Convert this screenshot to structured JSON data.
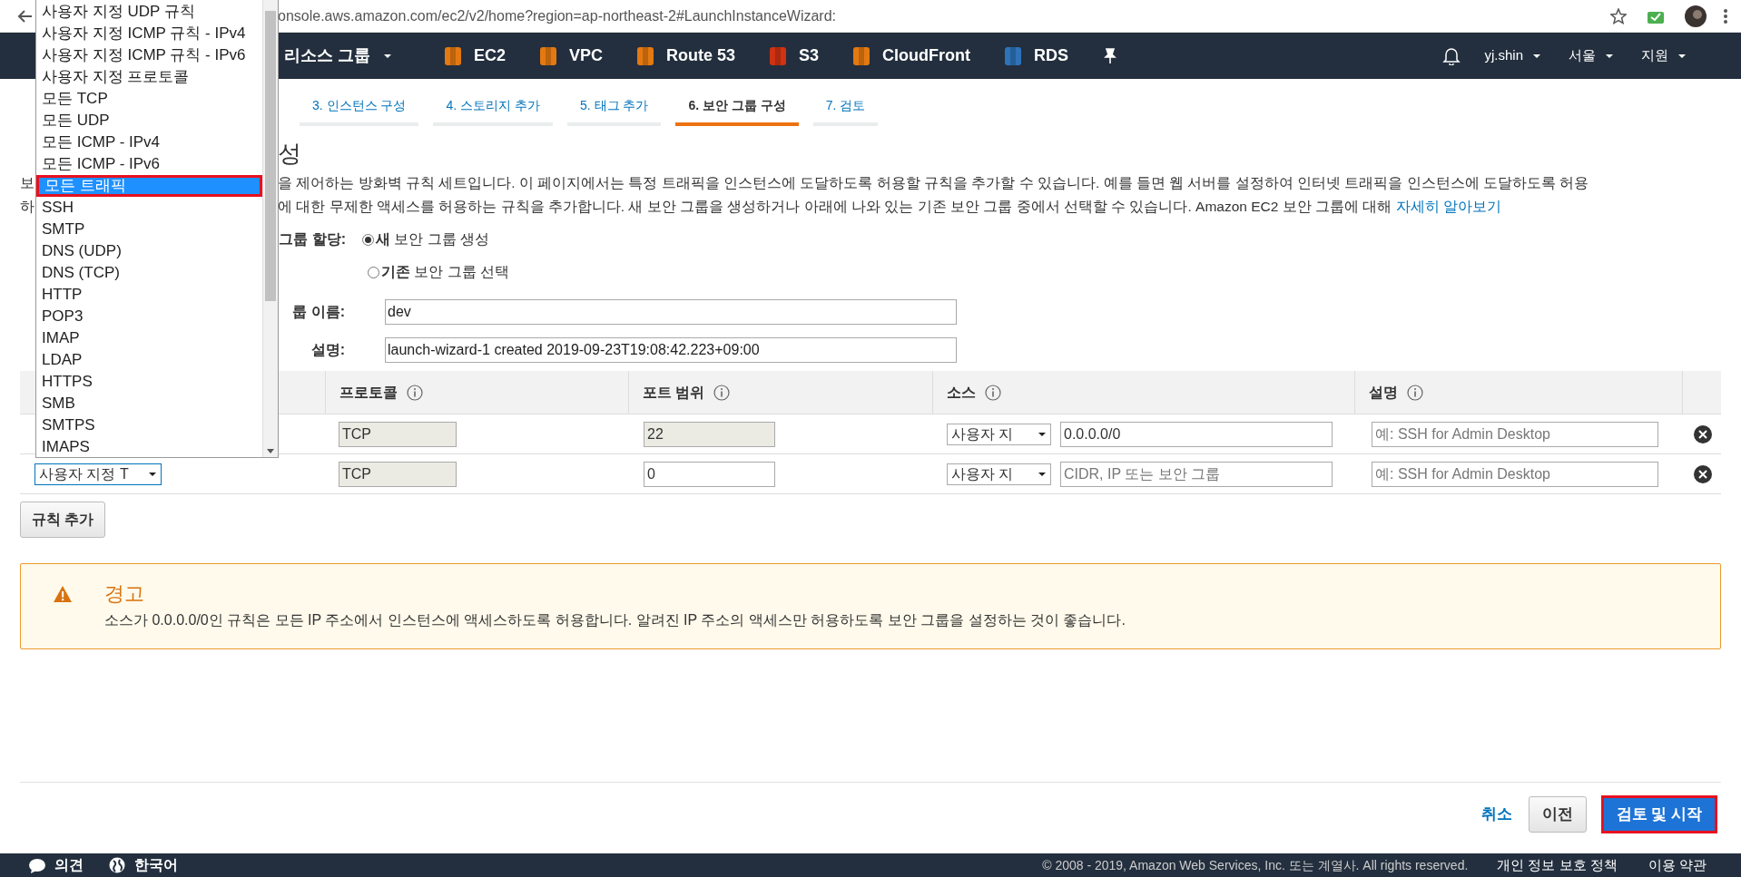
{
  "browser": {
    "url": "onsole.aws.amazon.com/ec2/v2/home?region=ap-northeast-2#LaunchInstanceWizard:"
  },
  "nav": {
    "menu": "리소스 그룹",
    "services": [
      {
        "label": "EC2",
        "color": "#e47911"
      },
      {
        "label": "VPC",
        "color": "#e47911"
      },
      {
        "label": "Route 53",
        "color": "#e47911"
      },
      {
        "label": "S3",
        "color": "#d13212"
      },
      {
        "label": "CloudFront",
        "color": "#e47911"
      },
      {
        "label": "RDS",
        "color": "#2e73b8"
      }
    ],
    "right": [
      "yj.shin",
      "서울",
      "지원"
    ]
  },
  "wizard_steps": [
    {
      "label": "3. 인스턴스 구성",
      "selected": false
    },
    {
      "label": "4. 스토리지 추가",
      "selected": false
    },
    {
      "label": "5. 태그 추가",
      "selected": false
    },
    {
      "label": "6. 보안 그룹 구성",
      "selected": true
    },
    {
      "label": "7. 검토",
      "selected": false
    }
  ],
  "title": "성",
  "description": {
    "line1_left": "보",
    "line1": "을 제어하는 방화벽 규칙 세트입니다. 이 페이지에서는 특정 트래픽을 인스턴스에 도달하도록 허용할 규칙을 추가할 수 있습니다. 예를 들면 웹 서버를 설정하여 인터넷 트래픽을 인스턴스에 도달하도록 허용",
    "line2_left": "하",
    "line2": "에 대한 무제한 액세스를 허용하는 규칙을 추가합니다. 새 보안 그룹을 생성하거나 아래에 나와 있는 기존 보안 그룹 중에서 선택할 수 있습니다. Amazon EC2 보안 그룹에 대해",
    "link": "자세히 알아보기"
  },
  "assignment": {
    "label": "그룹 할당:",
    "options": [
      {
        "label": "**새** 보안 그룹 생성",
        "selected": true
      },
      {
        "label": "**기존** 보안 그룹 선택",
        "selected": false
      }
    ]
  },
  "fields": [
    {
      "label": "룹 이름:",
      "value": "dev"
    },
    {
      "label": "설명:",
      "value": "launch-wizard-1 created 2019-09-23T19:08:42.223+09:00"
    }
  ],
  "rules": {
    "columns": [
      "프로토콜",
      "포트 범위",
      "소스",
      "설명"
    ],
    "rows": [
      {
        "protocol": "TCP",
        "port": "22",
        "port_disabled": true,
        "source_type": "사용자 지",
        "source": "0.0.0.0/0",
        "description_placeholder": "예: SSH for Admin Desktop"
      },
      {
        "type": "사용자 지정 T",
        "protocol": "TCP",
        "port": "0",
        "port_disabled": false,
        "source_type": "사용자 지",
        "source_placeholder": "CIDR, IP 또는 보안 그룹",
        "description_placeholder": "예: SSH for Admin Desktop"
      }
    ]
  },
  "type_dropdown": [
    {
      "label": "사용자 지정 UDP 규칙",
      "selected": false
    },
    {
      "label": "사용자 지정 ICMP 규칙 - IPv4",
      "selected": false
    },
    {
      "label": "사용자 지정 ICMP 규칙 - IPv6",
      "selected": false
    },
    {
      "label": "사용자 지정 프로토콜",
      "selected": false
    },
    {
      "label": "모든 TCP",
      "selected": false
    },
    {
      "label": "모든 UDP",
      "selected": false
    },
    {
      "label": "모든 ICMP - IPv4",
      "selected": false
    },
    {
      "label": "모든 ICMP - IPv6",
      "selected": false
    },
    {
      "label": "모든 트래픽",
      "selected": true
    },
    {
      "label": "SSH",
      "selected": false
    },
    {
      "label": "SMTP",
      "selected": false
    },
    {
      "label": "DNS (UDP)",
      "selected": false
    },
    {
      "label": "DNS (TCP)",
      "selected": false
    },
    {
      "label": "HTTP",
      "selected": false
    },
    {
      "label": "POP3",
      "selected": false
    },
    {
      "label": "IMAP",
      "selected": false
    },
    {
      "label": "LDAP",
      "selected": false
    },
    {
      "label": "HTTPS",
      "selected": false
    },
    {
      "label": "SMB",
      "selected": false
    },
    {
      "label": "SMTPS",
      "selected": false
    },
    {
      "label": "IMAPS",
      "selected": false
    }
  ],
  "add_rule": "규칙 추가",
  "warning": {
    "title": "경고",
    "text": "소스가 0.0.0.0/0인 규칙은 모든 IP 주소에서 인스턴스에 액세스하도록 허용합니다. 알려진 IP 주소의 액세스만 허용하도록 보안 그룹을 설정하는 것이 좋습니다."
  },
  "actions": {
    "cancel": "취소",
    "back": "이전",
    "primary": "검토 및 시작"
  },
  "footer": {
    "feedback": "의견",
    "language": "한국어",
    "copyright": "© 2008 - 2019, Amazon Web Services, Inc. 또는 계열사. All rights reserved.",
    "links": [
      "개인 정보 보호 정책",
      "이용 약관"
    ]
  }
}
